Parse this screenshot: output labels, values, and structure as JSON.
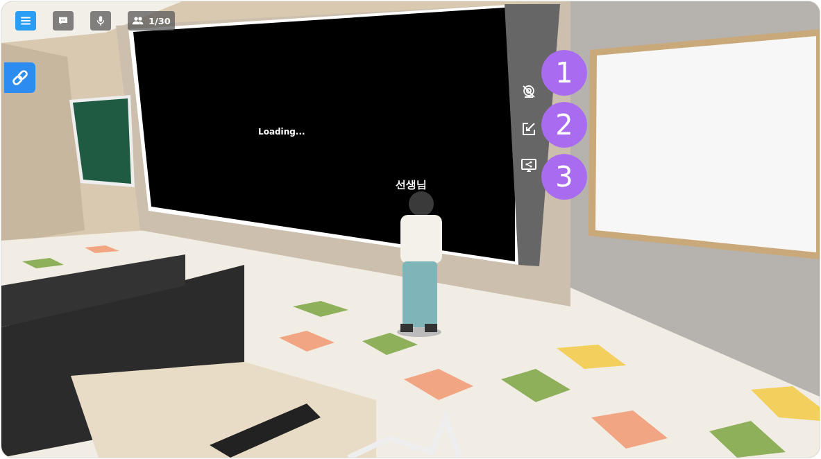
{
  "toolbar": {
    "items": [
      {
        "kind": "menu",
        "highlighted": true
      },
      {
        "kind": "chat",
        "highlighted": false
      },
      {
        "kind": "mic",
        "highlighted": false
      },
      {
        "kind": "participants",
        "highlighted": false,
        "label": "1/30"
      }
    ]
  },
  "share_link": {
    "kind": "link"
  },
  "screen": {
    "status": "Loading..."
  },
  "avatar": {
    "name": "선생님"
  },
  "screen_controls": [
    {
      "kind": "hide-camera",
      "callout": "1"
    },
    {
      "kind": "popout",
      "callout": "2"
    },
    {
      "kind": "share-screen",
      "callout": "3"
    }
  ]
}
